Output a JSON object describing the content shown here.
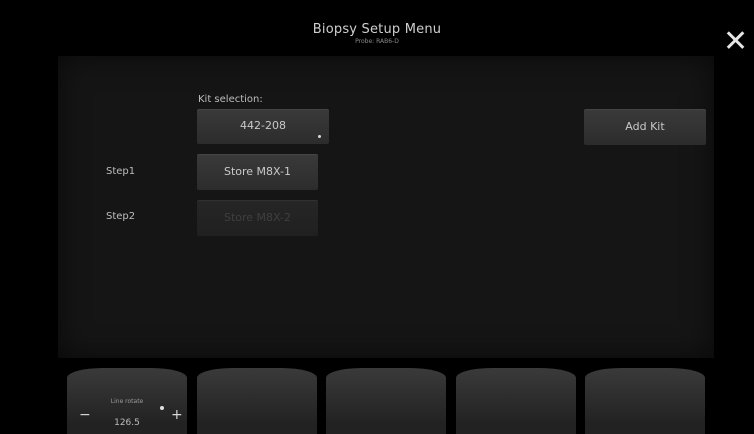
{
  "header": {
    "title": "Biopsy Setup Menu",
    "subtitle": "Probe: RAB6-D"
  },
  "close": {
    "icon": "close-icon",
    "glyph": "✕"
  },
  "panel": {
    "kit_selection_label": "Kit selection:",
    "kit_selection_value": "442-208",
    "add_kit_label": "Add Kit",
    "steps": [
      {
        "label": "Step1",
        "button": "Store M8X-1",
        "enabled": true
      },
      {
        "label": "Step2",
        "button": "Store M8X-2",
        "enabled": false
      }
    ]
  },
  "softkeys": {
    "first": {
      "label": "Line rotate",
      "value": "126.5",
      "minus": "−",
      "plus": "+"
    }
  },
  "colors": {
    "background": "#000000",
    "panel": "#151515",
    "button": "#333333",
    "text": "#c9c9c9"
  }
}
